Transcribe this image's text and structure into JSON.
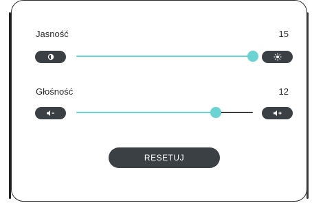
{
  "brightness": {
    "label": "Jasność",
    "value": "15",
    "level": 1.0,
    "minus_icon": "contrast-icon",
    "plus_icon": "sun-icon"
  },
  "volume": {
    "label": "Głośność",
    "value": "12",
    "level": 0.79,
    "minus_icon": "volume-down-icon",
    "plus_icon": "volume-up-icon"
  },
  "reset_label": "RESETUJ",
  "colors": {
    "accent": "#6cd3d3",
    "dark": "#3b4045",
    "track_inactive": "#3b3b3b"
  }
}
